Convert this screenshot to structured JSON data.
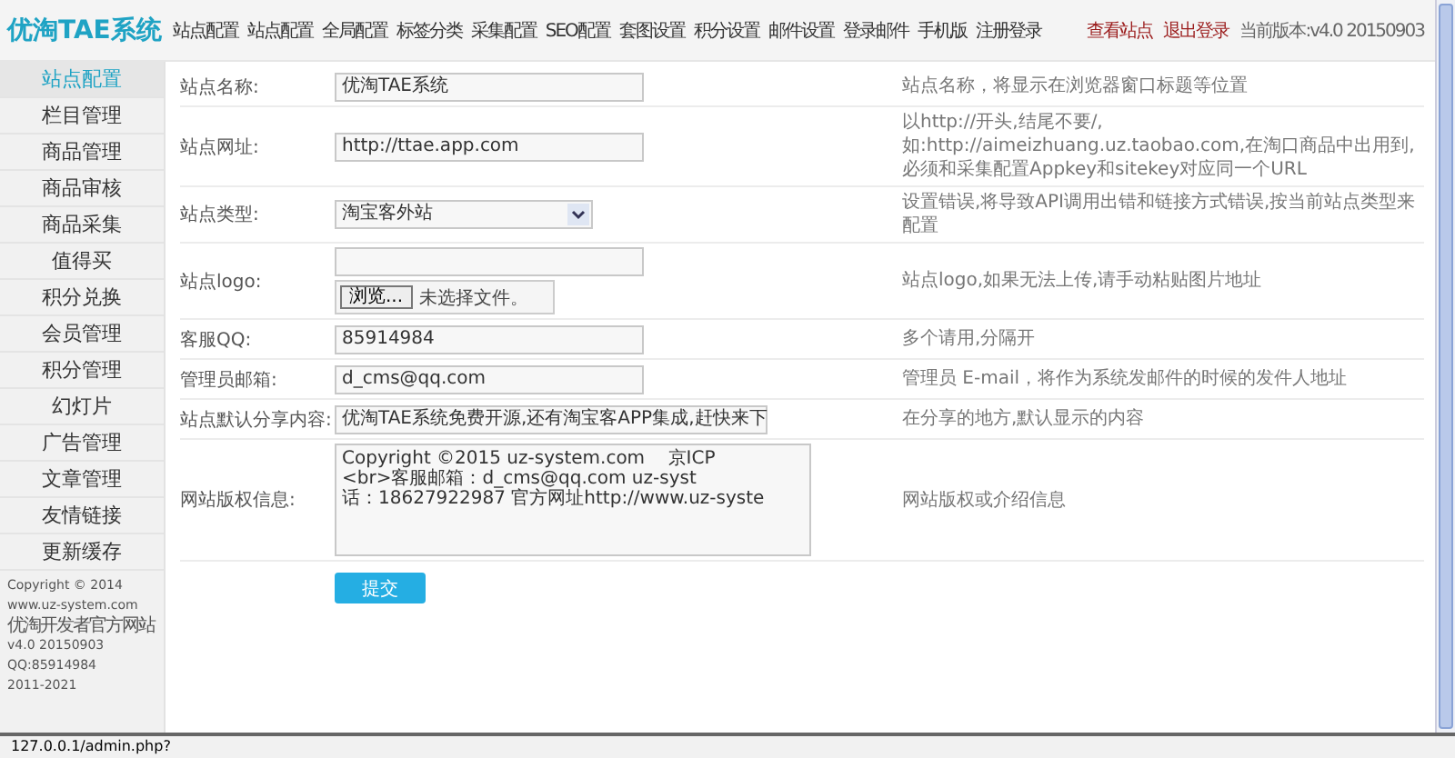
{
  "logo": "优淘TAE系统",
  "nav": [
    "站点配置",
    "站点配置",
    "全局配置",
    "标签分类",
    "采集配置",
    "SEO配置",
    "套图设置",
    "积分设置",
    "邮件设置",
    "登录邮件",
    "手机版",
    "注册登录"
  ],
  "header_right": [
    {
      "kind": "link",
      "text": "查看站点"
    },
    {
      "kind": "link",
      "text": "退出登录"
    },
    {
      "kind": "text",
      "text": "当前版本:v4.0 20150903"
    }
  ],
  "sidebar": {
    "items": [
      {
        "label": "站点配置",
        "selected": true
      },
      {
        "label": "栏目管理",
        "selected": false
      },
      {
        "label": "商品管理",
        "selected": false
      },
      {
        "label": "商品审核",
        "selected": false
      },
      {
        "label": "商品采集",
        "selected": false
      },
      {
        "label": "值得买",
        "selected": false
      },
      {
        "label": "积分兑换",
        "selected": false
      },
      {
        "label": "会员管理",
        "selected": false
      },
      {
        "label": "积分管理",
        "selected": false
      },
      {
        "label": "幻灯片",
        "selected": false
      },
      {
        "label": "广告管理",
        "selected": false
      },
      {
        "label": "文章管理",
        "selected": false
      },
      {
        "label": "友情链接",
        "selected": false
      },
      {
        "label": "更新缓存",
        "selected": false
      }
    ],
    "footer": [
      "Copyright © 2014",
      "www.uz-system.com",
      "优淘开发者官方网站",
      "v4.0 20150903",
      "QQ:85914984",
      "2011-2021"
    ]
  },
  "form": {
    "rows": [
      {
        "kind": "text",
        "label": "站点名称:",
        "value": "优淘TAE系统",
        "hint": "站点名称，将显示在浏览器窗口标题等位置"
      },
      {
        "kind": "text",
        "label": "站点网址:",
        "value": "http://ttae.app.com",
        "hint": "以http://开头,结尾不要/,如:http://aimeizhuang.uz.taobao.com,在淘口商品中出用到,必须和采集配置Appkey和sitekey对应同一个URL"
      },
      {
        "kind": "select",
        "label": "站点类型:",
        "value": "淘宝客外站",
        "hint": "设置错误,将导致API调用出错和链接方式错误,按当前站点类型来配置"
      },
      {
        "kind": "file",
        "label": "站点logo:",
        "value": "",
        "button": "浏览...",
        "file_status": "未选择文件。",
        "hint": "站点logo,如果无法上传,请手动粘贴图片地址"
      },
      {
        "kind": "text",
        "label": "客服QQ:",
        "value": "85914984",
        "hint": "多个请用,分隔开"
      },
      {
        "kind": "text",
        "label": "管理员邮箱:",
        "value": "d_cms@qq.com",
        "hint": "管理员 E-mail，将作为系统发邮件的时候的发件人地址"
      },
      {
        "kind": "text",
        "label": "站点默认分享内容:",
        "value": "优淘TAE系统免费开源,还有淘宝客APP集成,赶快来下",
        "hint": "在分享的地方,默认显示的内容"
      },
      {
        "kind": "textarea",
        "label": "网站版权信息:",
        "lines": [
          "Copyright ©2015 uz-system.com    京ICP",
          "<br>客服邮箱：d_cms@qq.com uz-syst",
          "话：18627922987 官方网址http://www.uz-syste"
        ],
        "hint": "网站版权或介绍信息"
      }
    ],
    "submit": "提交"
  },
  "status_bar": "127.0.0.1/admin.php?"
}
